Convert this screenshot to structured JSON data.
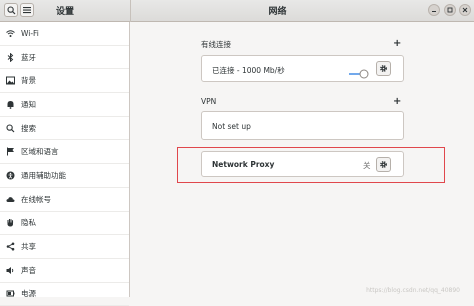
{
  "sidebar_header": {
    "title": "设置",
    "search_icon": "search-icon",
    "menu_icon": "hamburger-menu-icon"
  },
  "main_header": {
    "title": "网络"
  },
  "sidebar": {
    "items": [
      {
        "label": "Wi-Fi",
        "icon": "wifi-icon"
      },
      {
        "label": "蓝牙",
        "icon": "bluetooth-icon"
      },
      {
        "label": "背景",
        "icon": "background-icon"
      },
      {
        "label": "通知",
        "icon": "bell-icon"
      },
      {
        "label": "搜索",
        "icon": "search-icon"
      },
      {
        "label": "区域和语言",
        "icon": "flag-icon"
      },
      {
        "label": "通用辅助功能",
        "icon": "accessibility-icon"
      },
      {
        "label": "在线帐号",
        "icon": "cloud-icon"
      },
      {
        "label": "隐私",
        "icon": "hand-icon"
      },
      {
        "label": "共享",
        "icon": "share-icon"
      },
      {
        "label": "声音",
        "icon": "speaker-icon"
      },
      {
        "label": "电源",
        "icon": "power-icon"
      }
    ]
  },
  "wired": {
    "title": "有线连接",
    "add_label": "+",
    "status": "已连接 - 1000 Mb/秒",
    "toggle_on": true
  },
  "vpn": {
    "title": "VPN",
    "add_label": "+",
    "status": "Not set up"
  },
  "proxy": {
    "label": "Network Proxy",
    "state": "关"
  },
  "watermark": "https://blog.csdn.net/qq_40890"
}
